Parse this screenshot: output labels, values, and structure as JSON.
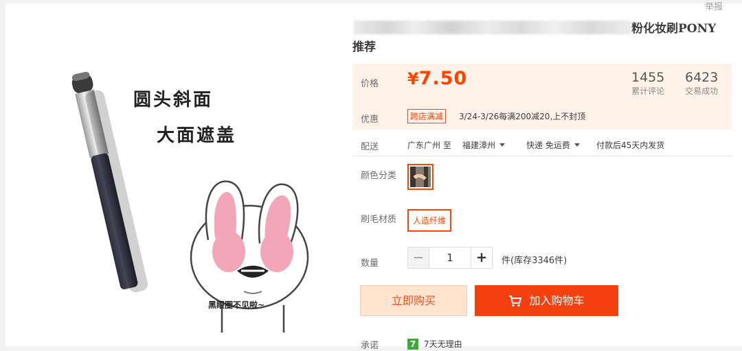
{
  "header": {
    "report_label": "举报"
  },
  "product": {
    "title_tail": "粉化妆刷PONY",
    "title_line2": "推荐",
    "image": {
      "slogan_line1": "圆头斜面",
      "slogan_line2": "大面遮盖",
      "caption": "黑眼圈不见啦~"
    }
  },
  "price": {
    "label": "价格",
    "currency": "¥",
    "value": "7.50",
    "reviews_count": "1455",
    "reviews_label": "累计评论",
    "trades_count": "6423",
    "trades_label": "交易成功"
  },
  "promo": {
    "label": "优惠",
    "tag": "跨店满减",
    "text": "3/24-3/26每满200减20,上不封顶"
  },
  "shipping": {
    "label": "配送",
    "from": "广东广州 至",
    "to": "福建漳州",
    "method": "快递 免运费",
    "note": "付款后45天内发货"
  },
  "options": {
    "color_label": "颜色分类",
    "material_label": "刷毛材质",
    "material_value": "人造纤维"
  },
  "quantity": {
    "label": "数量",
    "minus": "−",
    "value": "1",
    "plus": "+",
    "stock": "件(库存3346件)"
  },
  "actions": {
    "buy_now": "立即购买",
    "add_to_cart": "加入购物车"
  },
  "promise": {
    "label": "承诺",
    "icon_text": "7",
    "text": "7天无理由"
  },
  "colors": {
    "accent": "#ff4400",
    "price_bg": "#fff2e8",
    "cart_bg": "#f4400f",
    "buy_bg": "#ffe4d0"
  }
}
